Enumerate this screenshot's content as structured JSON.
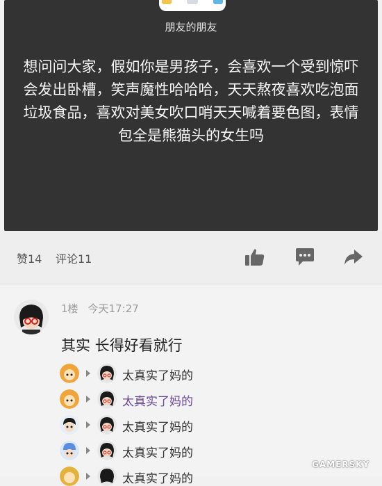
{
  "post": {
    "author_name": "朋友的朋友",
    "text": "想问问大家，假如你是男孩子，会喜欢一个受到惊吓会发出卧槽，笑声魔性哈哈哈，天天熬夜喜欢吃泡面垃圾食品，喜欢对美女吹口哨天天喊着要色图，表情包全是熊猫头的女生吗"
  },
  "actions": {
    "likes_label": "赞14",
    "comments_label": "评论11",
    "icons": [
      "thumbs-up-icon",
      "reply-bubble-icon",
      "share-arrow-icon"
    ]
  },
  "comment": {
    "floor": "1楼",
    "time": "今天17:27",
    "text": "其实 长得好看就行",
    "replies": [
      {
        "text": "太真实了妈的",
        "avatar_color": "#f0a53a",
        "highlight": false
      },
      {
        "text": "太真实了妈的",
        "avatar_color": "#f0a53a",
        "highlight": true
      },
      {
        "text": "太真实了妈的",
        "avatar_color": "#3a7bd5",
        "highlight": false
      },
      {
        "text": "太真实了妈的",
        "avatar_color": "#5b8de0",
        "highlight": false
      },
      {
        "text": "太真实了妈的",
        "avatar_color": "#e3b23a",
        "highlight": false
      }
    ]
  },
  "colors": {
    "post_bg": "#333334",
    "page_bg": "#f1f1f1",
    "highlight_text": "#6a4a9c"
  },
  "watermark": "GAMERSKY"
}
